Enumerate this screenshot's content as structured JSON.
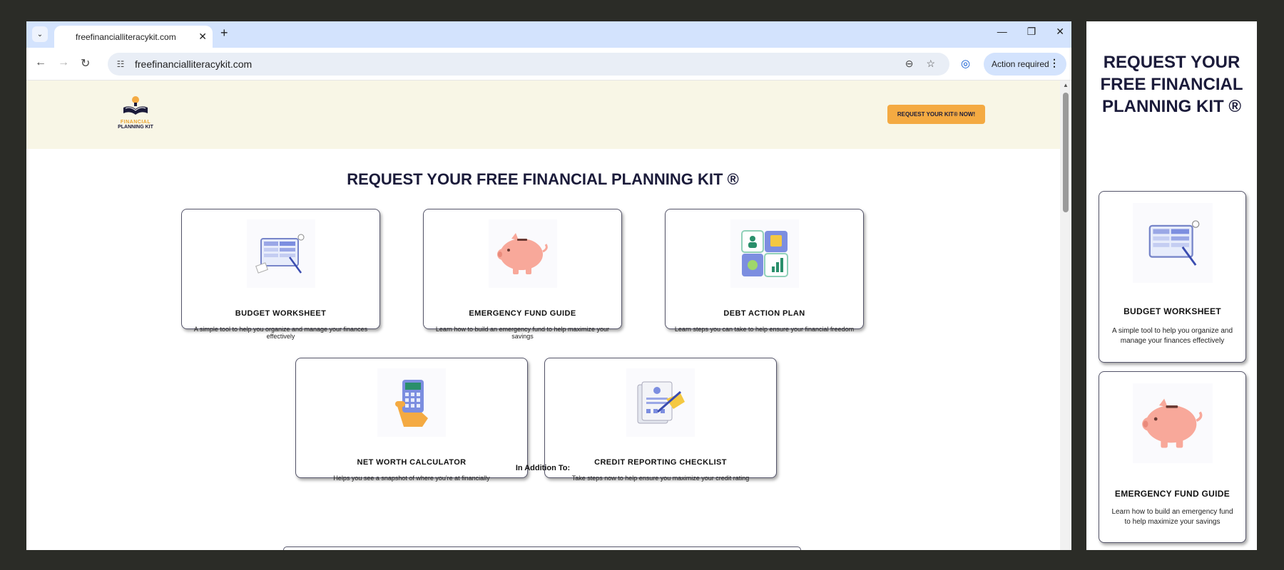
{
  "browser": {
    "tab_title": "freefinancialliteracykit.com",
    "tab_close": "✕",
    "new_tab": "+",
    "tab_menu": "⌄",
    "win_minimize": "—",
    "win_restore": "❐",
    "win_close": "✕",
    "back": "←",
    "forward": "→",
    "reload": "↻",
    "site_info": "☷",
    "url": "freefinancialliteracykit.com",
    "zoom": "⊖",
    "bookmark": "☆",
    "profile": "◎",
    "action_required": "Action required",
    "menu_dots": "⋮",
    "scroll_up": "▲"
  },
  "site": {
    "logo_line1": "FINANCIAL",
    "logo_line2": "PLANNING KIT",
    "cta_label": "REQUEST YOUR KIT® NOW!",
    "title": "REQUEST YOUR FREE FINANCIAL PLANNING KIT ®",
    "cards": [
      {
        "title": "BUDGET WORKSHEET",
        "desc": "A simple tool to help you organize and manage your finances effectively",
        "icon": "budget-worksheet-icon"
      },
      {
        "title": "EMERGENCY FUND GUIDE",
        "desc": "Learn how to build an emergency fund to help maximize your savings",
        "icon": "piggy-bank-icon"
      },
      {
        "title": "DEBT ACTION PLAN",
        "desc": "Learn steps you can take to help ensure your financial freedom",
        "icon": "puzzle-icon"
      },
      {
        "title": "NET WORTH CALCULATOR",
        "desc": "Helps you see a snapshot of where you're at financially",
        "icon": "calculator-icon"
      },
      {
        "title": "CREDIT REPORTING CHECKLIST",
        "desc": "Take steps now to help ensure you maximize your credit rating",
        "icon": "checklist-icon"
      }
    ],
    "addition_label": "In Addition To:"
  },
  "side_panel": {
    "title": "REQUEST YOUR FREE FINANCIAL PLANNING KIT ®",
    "cards": [
      {
        "title": "BUDGET WORKSHEET",
        "desc": "A simple tool to help you organize and manage your finances effectively"
      },
      {
        "title": "EMERGENCY FUND GUIDE",
        "desc": "Learn how to build an emergency fund to help maximize your savings"
      }
    ]
  },
  "colors": {
    "accent": "#f4aa42",
    "navy": "#1b1b3a",
    "header_bg": "#f8f6e6",
    "chrome_blue": "#d3e3fd"
  }
}
